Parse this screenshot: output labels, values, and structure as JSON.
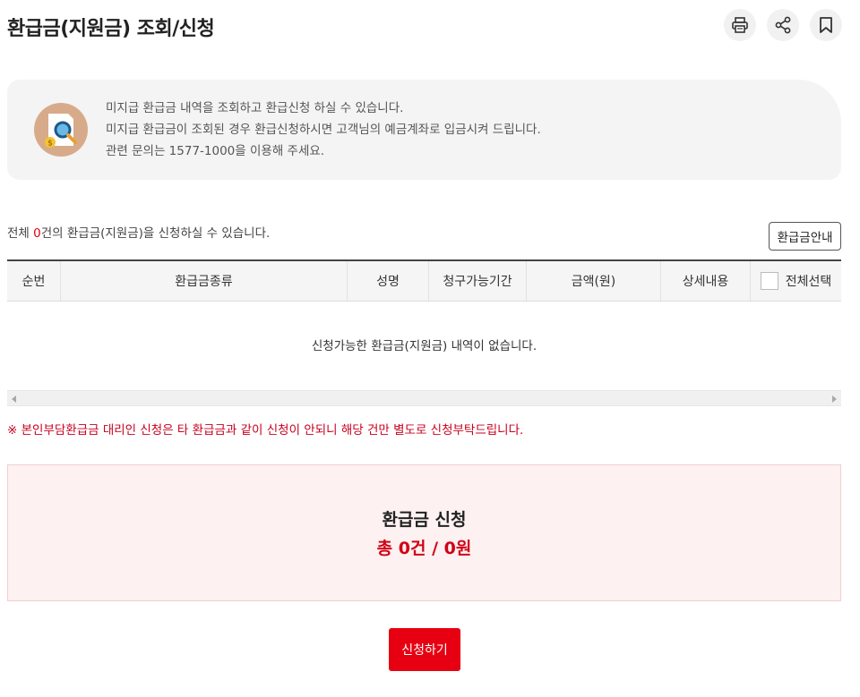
{
  "header": {
    "title": "환급금(지원금) 조회/신청",
    "actions": [
      {
        "name": "print-icon"
      },
      {
        "name": "share-icon"
      },
      {
        "name": "bookmark-icon"
      }
    ]
  },
  "info": {
    "icon": "search-document-icon",
    "lines": [
      "미지급 환급금 내역을 조회하고 환급신청 하실 수 있습니다.",
      "미지급 환급금이 조회된 경우 환급신청하시면 고객님의 예금계좌로 입금시켜 드립니다.",
      "관련 문의는 1577-1000을 이용해 주세요."
    ]
  },
  "summary": {
    "prefix": "전체 ",
    "count": "0",
    "suffix": "건의 환급금(지원금)을 신청하실 수 있습니다.",
    "guide_button": "환급금안내"
  },
  "table": {
    "columns": [
      "순번",
      "환급금종류",
      "성명",
      "청구가능기간",
      "금액(원)",
      "상세내용",
      "전체선택"
    ],
    "empty_message": "신청가능한 환급금(지원금) 내역이 없습니다."
  },
  "notice": "※ 본인부담환급금 대리인 신청은 타 환급금과 같이 신청이 안되니 해당 건만 별도로 신청부탁드립니다.",
  "apply": {
    "title": "환급금 신청",
    "total": "총 0건 / 0원",
    "button": "신청하기"
  },
  "colors": {
    "accent": "#e60012",
    "notice": "#c8001e",
    "apply_bg": "#fdf1f1"
  }
}
